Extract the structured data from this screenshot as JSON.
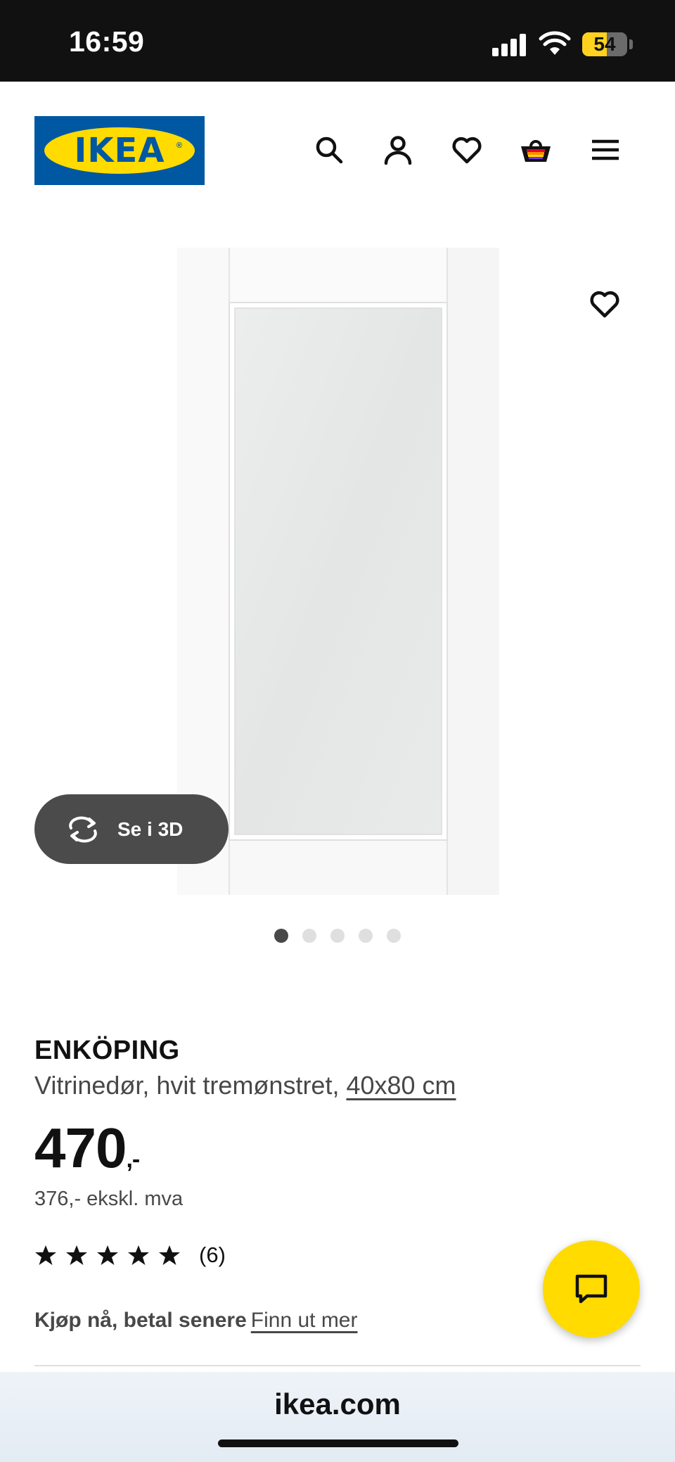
{
  "status_bar": {
    "time": "16:59",
    "battery_level": "54",
    "battery_percent": 54
  },
  "header": {
    "logo_text": "IKEA",
    "logo_mark": "®",
    "icons": [
      "search-icon",
      "account-icon",
      "heart-icon",
      "basket-icon",
      "menu-icon"
    ]
  },
  "gallery": {
    "view_3d_label": "Se i 3D",
    "slide_count": 5,
    "active_slide": 1
  },
  "product": {
    "name": "ENKÖPING",
    "description": "Vitrinedør, hvit tremønstret, ",
    "size": "40x80 cm",
    "price": "470",
    "price_suffix": ",-",
    "price_excl_vat": "376,- ekskl. mva",
    "rating_stars": 5,
    "review_count": "(6)",
    "bnpl_text": "Kjøp nå, betal senere",
    "bnpl_link": "Finn ut mer"
  },
  "browser": {
    "url": "ikea.com"
  },
  "colors": {
    "ikea_blue": "#0058a3",
    "ikea_yellow": "#ffdb00",
    "text_primary": "#111111",
    "text_secondary": "#484848",
    "button_3d_bg": "#4b4b4b"
  }
}
